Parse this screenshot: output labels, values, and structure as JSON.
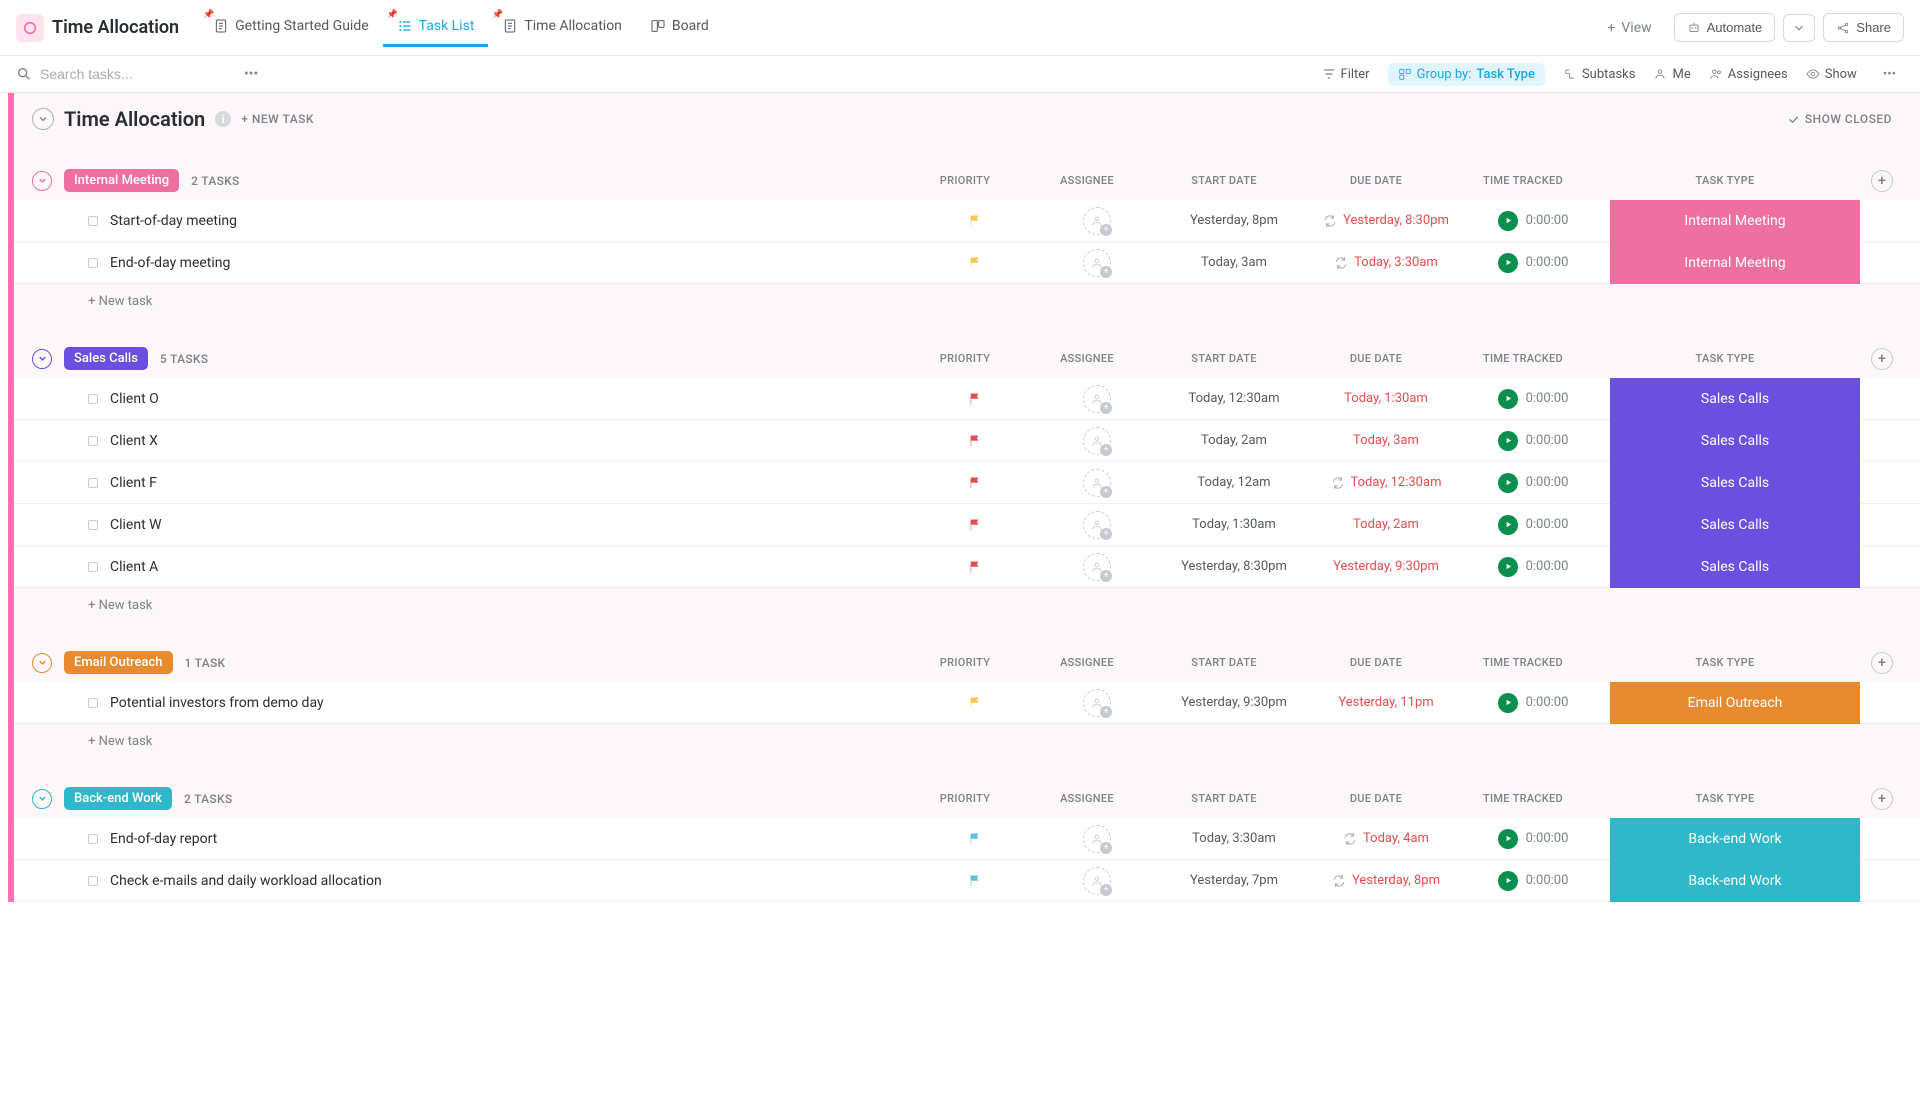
{
  "app": {
    "title": "Time Allocation"
  },
  "tabs": [
    {
      "label": "Getting Started Guide",
      "pinned": true,
      "icon": "doc"
    },
    {
      "label": "Task List",
      "pinned": true,
      "icon": "list",
      "active": true
    },
    {
      "label": "Time Allocation",
      "pinned": true,
      "icon": "doc"
    },
    {
      "label": "Board",
      "pinned": false,
      "icon": "board"
    }
  ],
  "add_view_label": "View",
  "topbar_buttons": {
    "automate": "Automate",
    "share": "Share"
  },
  "search": {
    "placeholder": "Search tasks..."
  },
  "toolbar": {
    "filter": "Filter",
    "group_by_label": "Group by:",
    "group_by_value": "Task Type",
    "subtasks": "Subtasks",
    "me": "Me",
    "assignees": "Assignees",
    "show": "Show"
  },
  "list": {
    "title": "Time Allocation",
    "new_task": "+ NEW TASK",
    "show_closed": "SHOW CLOSED"
  },
  "columns": {
    "priority": "PRIORITY",
    "assignee": "ASSIGNEE",
    "start_date": "START DATE",
    "due_date": "DUE DATE",
    "time_tracked": "TIME TRACKED",
    "task_type": "TASK TYPE"
  },
  "new_task_row": "+ New task",
  "colors": {
    "internal_meeting": "#ee6fa0",
    "sales_calls": "#6a4fe0",
    "email_outreach": "#e88b2e",
    "backend_work": "#2eb8c9",
    "flag_yellow": "#f3c94b",
    "flag_red": "#e04f4f",
    "flag_blue": "#5bc0de"
  },
  "groups": [
    {
      "name": "Internal Meeting",
      "color_key": "internal_meeting",
      "count": "2 TASKS",
      "tasks": [
        {
          "name": "Start-of-day meeting",
          "flag": "flag_yellow",
          "start": "Yesterday, 8pm",
          "due": "Yesterday, 8:30pm",
          "due_overdue": true,
          "recur": true,
          "time": "0:00:00",
          "type": "Internal Meeting"
        },
        {
          "name": "End-of-day meeting",
          "flag": "flag_yellow",
          "start": "Today, 3am",
          "due": "Today, 3:30am",
          "due_overdue": true,
          "recur": true,
          "time": "0:00:00",
          "type": "Internal Meeting"
        }
      ]
    },
    {
      "name": "Sales Calls",
      "color_key": "sales_calls",
      "count": "5 TASKS",
      "tasks": [
        {
          "name": "Client O",
          "flag": "flag_red",
          "start": "Today, 12:30am",
          "due": "Today, 1:30am",
          "due_overdue": true,
          "recur": false,
          "time": "0:00:00",
          "type": "Sales Calls"
        },
        {
          "name": "Client X",
          "flag": "flag_red",
          "start": "Today, 2am",
          "due": "Today, 3am",
          "due_overdue": true,
          "recur": false,
          "time": "0:00:00",
          "type": "Sales Calls"
        },
        {
          "name": "Client F",
          "flag": "flag_red",
          "start": "Today, 12am",
          "due": "Today, 12:30am",
          "due_overdue": true,
          "recur": true,
          "time": "0:00:00",
          "type": "Sales Calls"
        },
        {
          "name": "Client W",
          "flag": "flag_red",
          "start": "Today, 1:30am",
          "due": "Today, 2am",
          "due_overdue": true,
          "recur": false,
          "time": "0:00:00",
          "type": "Sales Calls"
        },
        {
          "name": "Client A",
          "flag": "flag_red",
          "start": "Yesterday, 8:30pm",
          "due": "Yesterday, 9:30pm",
          "due_overdue": true,
          "recur": false,
          "time": "0:00:00",
          "type": "Sales Calls"
        }
      ]
    },
    {
      "name": "Email Outreach",
      "color_key": "email_outreach",
      "count": "1 TASK",
      "tasks": [
        {
          "name": "Potential investors from demo day",
          "flag": "flag_yellow",
          "start": "Yesterday, 9:30pm",
          "due": "Yesterday, 11pm",
          "due_overdue": true,
          "recur": false,
          "time": "0:00:00",
          "type": "Email Outreach"
        }
      ]
    },
    {
      "name": "Back-end Work",
      "color_key": "backend_work",
      "count": "2 TASKS",
      "tasks": [
        {
          "name": "End-of-day report",
          "flag": "flag_blue",
          "start": "Today, 3:30am",
          "due": "Today, 4am",
          "due_overdue": true,
          "recur": true,
          "time": "0:00:00",
          "type": "Back-end Work"
        },
        {
          "name": "Check e-mails and daily workload allocation",
          "flag": "flag_blue",
          "start": "Yesterday, 7pm",
          "due": "Yesterday, 8pm",
          "due_overdue": true,
          "recur": true,
          "time": "0:00:00",
          "type": "Back-end Work"
        }
      ]
    }
  ]
}
